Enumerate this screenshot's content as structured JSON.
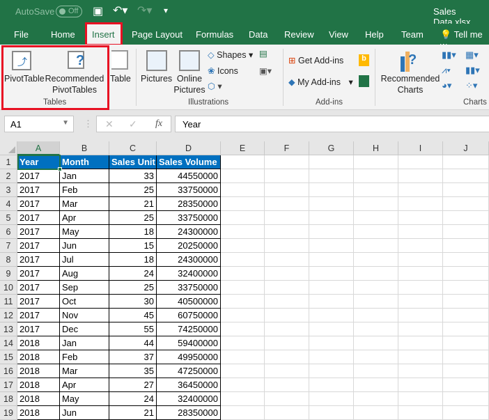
{
  "titlebar": {
    "autosave_label": "AutoSave",
    "autosave_state": "Off",
    "filename": "Sales Data.xlsx"
  },
  "tabs": [
    "File",
    "Home",
    "Insert",
    "Page Layout",
    "Formulas",
    "Data",
    "Review",
    "View",
    "Help",
    "Team"
  ],
  "tell_me": "Tell me w",
  "ribbon": {
    "pivottable": "PivotTable",
    "recommended_pivot_1": "Recommended",
    "recommended_pivot_2": "PivotTables",
    "table": "Table",
    "tables_group": "Tables",
    "pictures": "Pictures",
    "online_pictures_1": "Online",
    "online_pictures_2": "Pictures",
    "shapes": "Shapes",
    "icons": "Icons",
    "illustrations_group": "Illustrations",
    "get_addins": "Get Add-ins",
    "my_addins": "My Add-ins",
    "addins_group": "Add-ins",
    "recommended_charts_1": "Recommended",
    "recommended_charts_2": "Charts",
    "charts_group": "Charts"
  },
  "formula_bar": {
    "name_box": "A1",
    "fx": "fx",
    "value": "Year"
  },
  "columns": [
    "A",
    "B",
    "C",
    "D",
    "E",
    "F",
    "G",
    "H",
    "I",
    "J"
  ],
  "headers": [
    "Year",
    "Month",
    "Sales Unit",
    "Sales Volume"
  ],
  "rows": [
    [
      "2017",
      "Jan",
      "33",
      "44550000"
    ],
    [
      "2017",
      "Feb",
      "25",
      "33750000"
    ],
    [
      "2017",
      "Mar",
      "21",
      "28350000"
    ],
    [
      "2017",
      "Apr",
      "25",
      "33750000"
    ],
    [
      "2017",
      "May",
      "18",
      "24300000"
    ],
    [
      "2017",
      "Jun",
      "15",
      "20250000"
    ],
    [
      "2017",
      "Jul",
      "18",
      "24300000"
    ],
    [
      "2017",
      "Aug",
      "24",
      "32400000"
    ],
    [
      "2017",
      "Sep",
      "25",
      "33750000"
    ],
    [
      "2017",
      "Oct",
      "30",
      "40500000"
    ],
    [
      "2017",
      "Nov",
      "45",
      "60750000"
    ],
    [
      "2017",
      "Dec",
      "55",
      "74250000"
    ],
    [
      "2018",
      "Jan",
      "44",
      "59400000"
    ],
    [
      "2018",
      "Feb",
      "37",
      "49950000"
    ],
    [
      "2018",
      "Mar",
      "35",
      "47250000"
    ],
    [
      "2018",
      "Apr",
      "27",
      "36450000"
    ],
    [
      "2018",
      "May",
      "24",
      "32400000"
    ],
    [
      "2018",
      "Jun",
      "21",
      "28350000"
    ]
  ],
  "colors": {
    "excel_green": "#217346",
    "header_blue": "#0070c0",
    "highlight_red": "#e81123"
  }
}
